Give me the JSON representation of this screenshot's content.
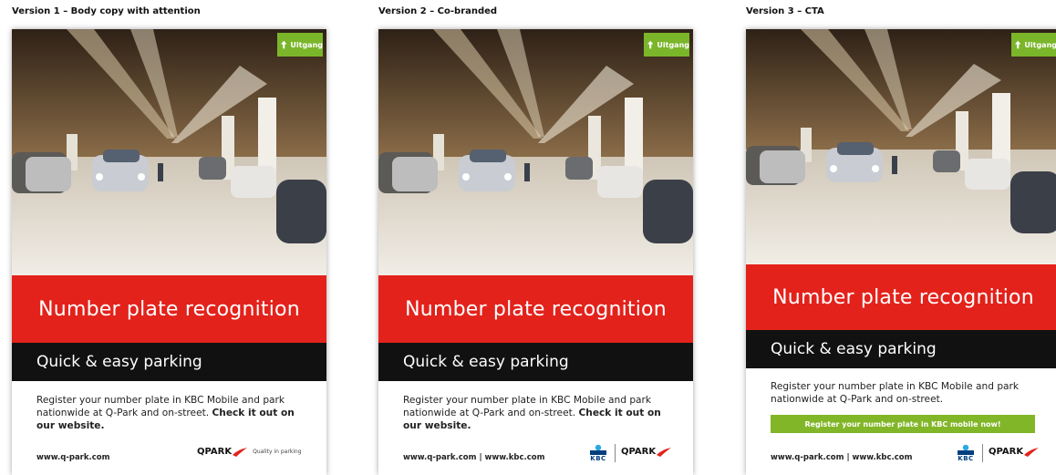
{
  "versions": [
    {
      "label": "Version 1 – Body copy with attention",
      "headline": "Number plate recognition",
      "subheadline": "Quick & easy parking",
      "body_line1": "Register your number plate in KBC Mobile and park",
      "body_line2a": "nationwide at Q-Park and on-street.",
      "body_bold1": "Check it out on",
      "body_bold2": "our website.",
      "url": "www.q-park.com",
      "logo": "QPARK",
      "tagline": "Quality in parking"
    },
    {
      "label": "Version 2 – Co-branded",
      "headline": "Number plate recognition",
      "subheadline": "Quick & easy parking",
      "body_line1": "Register your number plate in KBC Mobile and park",
      "body_line2a": "nationwide at Q-Park and on-street.",
      "body_bold1": "Check it out on",
      "body_bold2": "our website.",
      "url": "www.q-park.com | www.kbc.com",
      "logo": "QPARK",
      "kbc": "KBC"
    },
    {
      "label": "Version 3 – CTA",
      "headline": "Number plate recognition",
      "subheadline": "Quick & easy parking",
      "body_line1": "Register your number plate in KBC Mobile and park",
      "body_line2a": "nationwide at Q-Park and on-street.",
      "cta": "Register your number plate in KBC mobile now!",
      "url": "www.q-park.com | www.kbc.com",
      "logo": "QPARK",
      "kbc": "KBC"
    }
  ],
  "sign_text": "Uitgang",
  "colors": {
    "red": "#e3221b",
    "black": "#111111",
    "green": "#82b629",
    "kbc_blue": "#003f7d"
  },
  "icons": [
    "up-arrow-icon",
    "qpark-swoosh-icon",
    "kbc-logo-icon"
  ]
}
